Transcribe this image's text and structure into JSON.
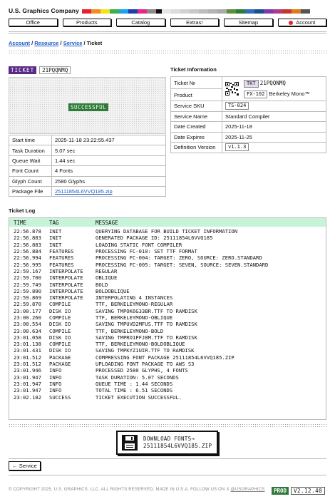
{
  "brand": "U.S. Graphics Company",
  "colors": {
    "swatches": [
      "#e5232e",
      "#f28c1f",
      "#f2e21b",
      "#3fae49",
      "#1aa3e8",
      "#1a3fb0",
      "#e8268a",
      "#8a8a8a",
      "#111111"
    ],
    "grays": [
      "#e6e6e6",
      "#dcdcdc",
      "#d2d2d2",
      "#c8c8c8",
      "#bebebe",
      "#b4b4b4",
      "#aaaaaa",
      "#5b8f3a",
      "#2f7a3a",
      "#2c6fb8",
      "#1a4f8f",
      "#7a3ab0",
      "#b03a8a",
      "#c0392b",
      "#e07a1f",
      "#555555"
    ],
    "accent_purple": "#5b2a86",
    "success_green": "#2f7a3a",
    "log_header": "#c7f3d8"
  },
  "nav": [
    "Office",
    "Products",
    "Catalog",
    "Extras!",
    "Sitemap",
    "Account"
  ],
  "breadcrumb": {
    "a": "Account",
    "b": "Resource",
    "c": "Service",
    "current": "Ticket"
  },
  "ticket": {
    "label": "TICKET",
    "id": "21PQQNMQ",
    "preview_status": "SUCCESSFUL",
    "rows": [
      {
        "k": "Start time",
        "v": "2025-11-18 23:22:55.437"
      },
      {
        "k": "Task Duration",
        "v": "5.07 sec"
      },
      {
        "k": "Queue Wait",
        "v": "1.44 sec"
      },
      {
        "k": "Font Count",
        "v": "4 Fonts"
      },
      {
        "k": "Glyph Count",
        "v": "2580 Glyphs"
      },
      {
        "k": "Package File",
        "v": "25111854L6VVQ185.zip"
      }
    ]
  },
  "info": {
    "title": "Ticket Information",
    "ticket_no_label": "Ticket №",
    "tkt_chip": "TKT",
    "tkt_value": "21PQQNMQ",
    "product_label": "Product",
    "product_chip": "FX-102",
    "product_name": "Berkeley Mono™",
    "sku_label": "Service SKU",
    "sku_value": "TS-024",
    "name_label": "Service Name",
    "name_value": "Standard Compiler",
    "created_label": "Date Created",
    "created_value": "2025-11-18",
    "expires_label": "Date Expires",
    "expires_value": "2025-11-25",
    "def_label": "Definition Version",
    "def_value": "v1.1.3"
  },
  "log": {
    "title": "Ticket Log",
    "headers": [
      "TIME",
      "TAG",
      "MESSAGE"
    ],
    "rows": [
      [
        "22:56.878",
        "INIT",
        "QUERYING DATABASE FOR BUILD TICKET INFORMATION"
      ],
      [
        "22:56.883",
        "INIT",
        "GENERATED PACKAGE ID: 25111854L6VVQ185"
      ],
      [
        "22:56.883",
        "INIT",
        "LOADING STATIC FONT COMPILER"
      ],
      [
        "22:56.884",
        "FEATURES",
        "PROCESSING FC-010: SET TTF FORMAT"
      ],
      [
        "22:56.994",
        "FEATURES",
        "PROCESSING FC-004: TARGET: ZERO, SOURCE: ZERO.STANDARD"
      ],
      [
        "22:56.995",
        "FEATURES",
        "PROCESSING FC-005: TARGET: SEVEN, SOURCE: SEVEN.STANDARD"
      ],
      [
        "22:59.167",
        "INTERPOLATE",
        "REGULAR"
      ],
      [
        "22:59.700",
        "INTERPOLATE",
        "OBLIQUE"
      ],
      [
        "22:59.749",
        "INTERPOLATE",
        "BOLD"
      ],
      [
        "22:59.800",
        "INTERPOLATE",
        "BOLDOBLIQUE"
      ],
      [
        "22:59.869",
        "INTERPOLATE",
        "INTERPOLATING 4 INSTANCES"
      ],
      [
        "22:59.870",
        "COMPILE",
        "TTF, BERKELEYMONO-REGULAR"
      ],
      [
        "23:00.177",
        "DISK IO",
        "SAVING TMPOK6G33BR.TTF TO RAMDISK"
      ],
      [
        "23:00.260",
        "COMPILE",
        "TTF, BERKELEYMONO-OBLIQUE"
      ],
      [
        "23:00.554",
        "DISK IO",
        "SAVING TMPUVD2MFUS.TTF TO RAMDISK"
      ],
      [
        "23:00.634",
        "COMPILE",
        "TTF, BERKELEYMONO-BOLD"
      ],
      [
        "23:01.058",
        "DISK IO",
        "SAVING TMPRO1PFJ8M.TTF TO RAMDISK"
      ],
      [
        "23:01.138",
        "COMPILE",
        "TTF, BERKELEYMONO-BOLDOBLIQUE"
      ],
      [
        "23:01.431",
        "DISK IO",
        "SAVING TMPKYZ1UIR.TTF TO RAMDISK"
      ],
      [
        "23:01.512",
        "PACKAGE",
        "COMPRESSING FONT PACKAGE 25111854L6VVQ185.ZIP"
      ],
      [
        "23:01.512",
        "PACKAGE",
        "UPLOADING FONT PACKAGE TO AWS S3"
      ],
      [
        "23:01.946",
        "INFO",
        "PROCESSED 2580 GLYPHS, 4 FONTS"
      ],
      [
        "23:01.947",
        "INFO",
        "TASK DURATION: 5.07 SECONDS"
      ],
      [
        "23:01.947",
        "INFO",
        "QUEUE TIME : 1.44 SECONDS"
      ],
      [
        "23:01.947",
        "INFO",
        "TOTAL TIME : 6.51 SECONDS"
      ],
      [
        "23:02.102",
        "SUCCESS",
        "TICKET EXECUTION SUCCESSFUL."
      ]
    ]
  },
  "download": {
    "line1": "DOWNLOAD FONTS→",
    "line2": "25111854L6VVQ185.ZIP",
    "icon": "floppy-disk-icon"
  },
  "back": "← Service",
  "footer": {
    "text": "© COPYRIGHT 2025. U.S. GRAPHICS, LLC. ALL RIGHTS RESERVED. MADE IN U.S.A. FOLLOW US ON X ",
    "handle": "@USGRAPHICS"
  },
  "env": {
    "label": "PROD",
    "version": "V2.12.40"
  }
}
